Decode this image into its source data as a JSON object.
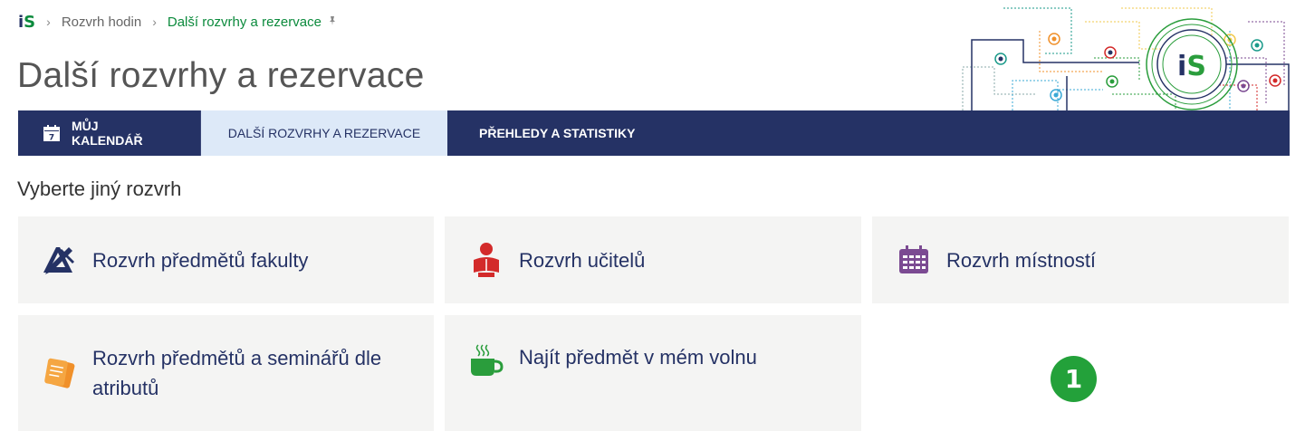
{
  "breadcrumb": {
    "logo": "iS",
    "items": [
      "Rozvrh hodin",
      "Další rozvrhy a rezervace"
    ],
    "pin_icon": "pin-icon"
  },
  "page_title": "Další rozvrhy a rezervace",
  "tabs": {
    "calendar": {
      "label": "MŮJ KALENDÁŘ",
      "icon": "calendar-icon",
      "icon_day": "7"
    },
    "other": {
      "label": "DALŠÍ ROZVRHY A REZERVACE"
    },
    "stats": {
      "label": "PŘEHLEDY A STATISTIKY"
    }
  },
  "section_heading": "Vyberte jiný rozvrh",
  "cards": [
    {
      "label": "Rozvrh předmětů fakulty",
      "icon": "pencil-ruler-icon",
      "color": "#253265"
    },
    {
      "label": "Rozvrh učitelů",
      "icon": "teacher-reading-icon",
      "color": "#d32a2a"
    },
    {
      "label": "Rozvrh místností",
      "icon": "room-calendar-icon",
      "color": "#7b4a92"
    },
    {
      "label": "Rozvrh předmětů a seminářů dle atributů",
      "icon": "notes-icon",
      "color": "#f0902a"
    },
    {
      "label": "Najít předmět v mém volnu",
      "icon": "coffee-cup-icon",
      "color": "#2a9d3c"
    }
  ],
  "badge": "1",
  "colors": {
    "navy": "#253265",
    "green": "#0b8a3c",
    "active_tab": "#dde9f8",
    "card_bg": "#f4f4f3"
  }
}
